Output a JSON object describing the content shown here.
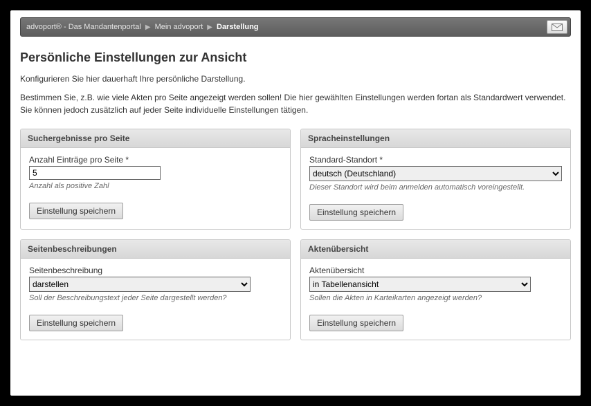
{
  "breadcrumb": {
    "items": [
      "advoport® - Das Mandantenportal",
      "Mein advoport",
      "Darstellung"
    ]
  },
  "page": {
    "title": "Persönliche Einstellungen zur Ansicht",
    "intro1": "Konfigurieren Sie hier dauerhaft Ihre persönliche Darstellung.",
    "intro2": "Bestimmen Sie, z.B. wie viele Akten pro Seite angezeigt werden sollen! Die hier gewählten Einstellungen werden fortan als Standardwert verwendet. Sie können jedoch zusätzlich auf jeder Seite individuelle Einstellungen tätigen."
  },
  "common": {
    "save_label": "Einstellung speichern"
  },
  "panels": {
    "results": {
      "title": "Suchergebnisse pro Seite",
      "field_label": "Anzahl Einträge pro Seite *",
      "value": "5",
      "hint": "Anzahl als positive Zahl"
    },
    "language": {
      "title": "Spracheinstellungen",
      "field_label": "Standard-Standort *",
      "value": "deutsch (Deutschland)",
      "hint": "Dieser Standort wird beim anmelden automatisch voreingestellt."
    },
    "pagedesc": {
      "title": "Seitenbeschreibungen",
      "field_label": "Seitenbeschreibung",
      "value": "darstellen",
      "hint": "Soll der Beschreibungstext jeder Seite dargestellt werden?"
    },
    "aktov": {
      "title": "Aktenübersicht",
      "field_label": "Aktenübersicht",
      "value": "in Tabellenansicht",
      "hint": "Sollen die Akten in Karteikarten angezeigt werden?"
    }
  }
}
